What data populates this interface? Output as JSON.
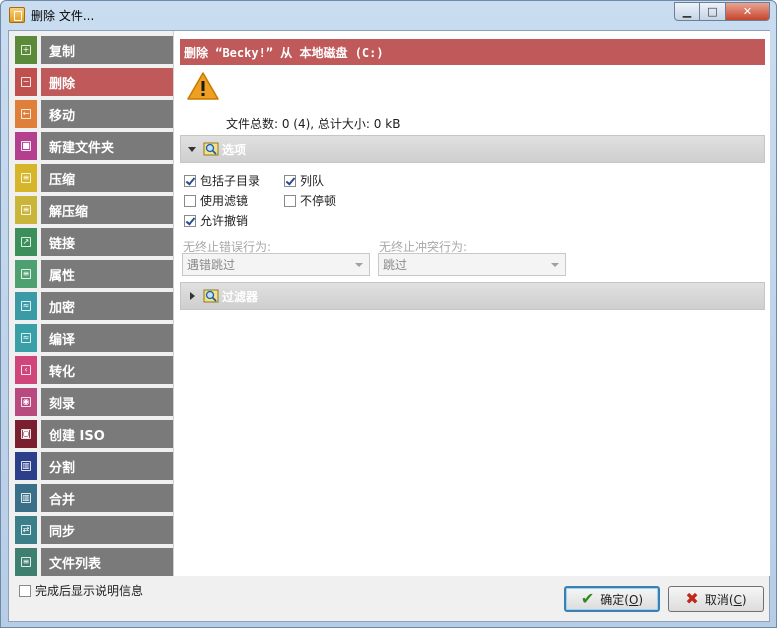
{
  "window": {
    "title": "删除 文件..."
  },
  "nav": {
    "items": [
      {
        "label": "复制",
        "color": "#5b8a3a",
        "glyph": "+"
      },
      {
        "label": "删除",
        "color": "#c0504d",
        "glyph": "−"
      },
      {
        "label": "移动",
        "color": "#e07f3a",
        "glyph": "←"
      },
      {
        "label": "新建文件夹",
        "color": "#b43f8f",
        "glyph": "■"
      },
      {
        "label": "压缩",
        "color": "#d6b52b",
        "glyph": "≡"
      },
      {
        "label": "解压缩",
        "color": "#c9b53a",
        "glyph": "≡"
      },
      {
        "label": "链接",
        "color": "#3a8f5a",
        "glyph": "↗"
      },
      {
        "label": "属性",
        "color": "#4fa070",
        "glyph": "≡"
      },
      {
        "label": "加密",
        "color": "#3a9aa6",
        "glyph": "≈"
      },
      {
        "label": "编译",
        "color": "#3aa0a8",
        "glyph": "≈"
      },
      {
        "label": "转化",
        "color": "#d0457a",
        "glyph": "‹"
      },
      {
        "label": "刻录",
        "color": "#b84a80",
        "glyph": "◉"
      },
      {
        "label": "创建 ISO",
        "color": "#7a1f30",
        "glyph": "◙"
      },
      {
        "label": "分割",
        "color": "#2c3f8a",
        "glyph": "▥"
      },
      {
        "label": "合并",
        "color": "#3a6f8a",
        "glyph": "▥"
      },
      {
        "label": "同步",
        "color": "#3a7f8a",
        "glyph": "⇄"
      },
      {
        "label": "文件列表",
        "color": "#3f7f70",
        "glyph": "≡"
      }
    ],
    "active_index": 1
  },
  "content": {
    "header": "删除 “Becky!” 从 本地磁盘 (C:)",
    "summary": "文件总数: 0 (4), 总计大小: 0 kB",
    "options_section": {
      "label": "选项",
      "expanded": true
    },
    "options": {
      "include_subdirs": {
        "label": "包括子目录",
        "checked": true
      },
      "queue": {
        "label": "列队",
        "checked": true
      },
      "use_filter": {
        "label": "使用滤镜",
        "checked": false
      },
      "no_pause": {
        "label": "不停顿",
        "checked": false
      },
      "allow_undo": {
        "label": "允许撤销",
        "checked": true
      }
    },
    "error_behavior": {
      "label": "无终止错误行为:",
      "value": "遇错跳过"
    },
    "conflict_behavior": {
      "label": "无终止冲突行为:",
      "value": "跳过"
    },
    "filter_section": {
      "label": "过滤器",
      "expanded": false
    }
  },
  "footer": {
    "show_info": {
      "label": "完成后显示说明信息",
      "checked": false
    },
    "ok": {
      "label": "确定(",
      "key": "O",
      "tail": ")"
    },
    "cancel": {
      "label": "取消(",
      "key": "C",
      "tail": ")"
    }
  },
  "colors": {
    "header_red": "#c05a5a",
    "nav_gray": "#7a7a7a",
    "warning_yellow": "#f0a020"
  }
}
